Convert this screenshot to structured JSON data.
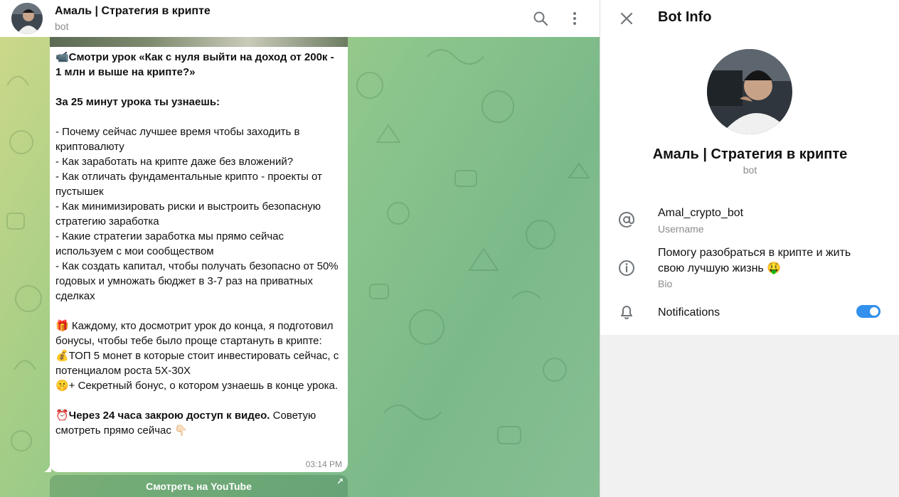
{
  "header": {
    "title": "Амаль | Стратегия в крипте",
    "subtitle": "bot",
    "search_icon": "search-icon",
    "menu_icon": "more-vertical-icon"
  },
  "message": {
    "p1": "📹Смотри урок «Как с нуля выйти на доход от 200к - 1 млн и выше на крипте?»",
    "p2": "За 25 минут урока ты узнаешь:",
    "list": "- Почему сейчас лучшее время чтобы заходить в криптовалюту\n- Как заработать на крипте даже без вложений?\n- Как отличать фундаментальные крипто - проекты от пустышек\n- Как минимизировать риски и выстроить безопасную стратегию заработка\n- Какие стратегии заработка мы прямо сейчас используем с мои сообществом\n- Как создать капитал, чтобы получать безопасно от 50% годовых и умножать бюджет в 3-7 раз на приватных сделках",
    "p3": "🎁 Каждому, кто досмотрит урок до конца, я подготовил бонусы, чтобы тебе было проще стартануть в крипте:\n💰ТОП 5 монет в которые стоит инвестировать сейчас, с потенциалом роста 5X-30X\n🤫+ Секретный бонус, о котором узнаешь в конце урока.",
    "p4_bold": "⏰Через 24 часа закрою доступ к видео.",
    "p4_rest": " Советую смотреть прямо сейчас 👇🏻",
    "time": "03:14 PM",
    "button": "Смотреть на YouTube"
  },
  "panel": {
    "title": "Bot Info",
    "name": "Амаль | Стратегия в крипте",
    "subtitle": "bot",
    "username_value": "Amal_crypto_bot",
    "username_label": "Username",
    "bio_value": "Помогу разобраться в крипте и жить свою лучшую жизнь 🤑",
    "bio_label": "Bio",
    "notifications_label": "Notifications",
    "notifications_on": true
  },
  "colors": {
    "accent": "#3390ec",
    "secondary_text": "#8b8b8b"
  }
}
